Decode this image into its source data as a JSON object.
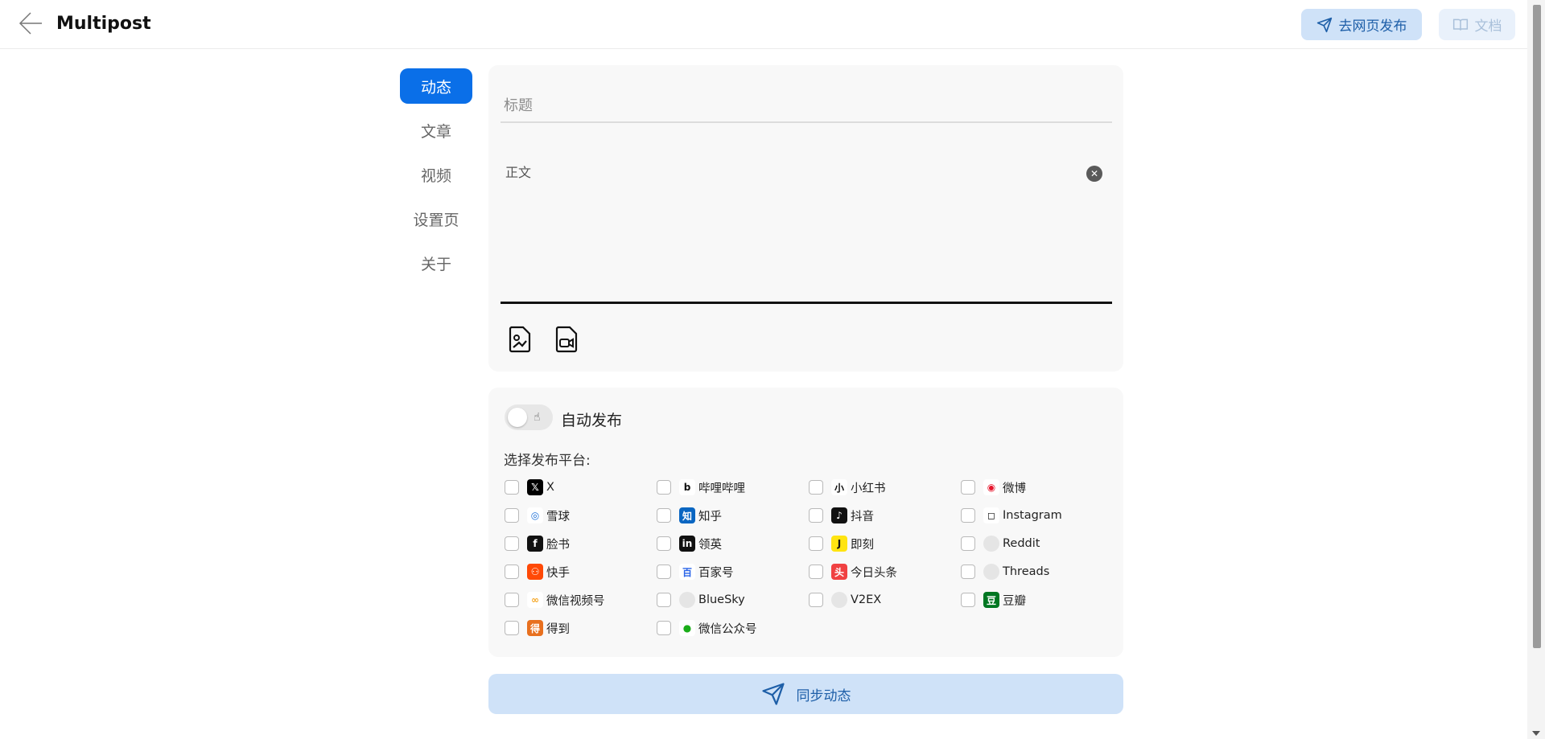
{
  "header": {
    "app_title": "Multipost",
    "web_publish_label": "去网页发布",
    "docs_label": "文档"
  },
  "nav": {
    "items": [
      {
        "label": "动态",
        "active": true
      },
      {
        "label": "文章",
        "active": false
      },
      {
        "label": "视频",
        "active": false
      },
      {
        "label": "设置页",
        "active": false
      },
      {
        "label": "关于",
        "active": false
      }
    ]
  },
  "editor": {
    "title_placeholder": "标题",
    "body_placeholder": "正文",
    "tools": [
      "image-upload-icon",
      "video-upload-icon"
    ]
  },
  "publish": {
    "auto_publish_label": "自动发布",
    "auto_publish_enabled": false,
    "choose_platform_label": "选择发布平台:",
    "platforms": [
      {
        "name": "X",
        "icon": "x-icon",
        "color": "#000000",
        "checked": false
      },
      {
        "name": "哔哩哔哩",
        "icon": "bilibili-icon",
        "color": "#ffffff",
        "checked": false
      },
      {
        "name": "小红书",
        "icon": "xiaohongshu-icon",
        "color": "#ffffff",
        "checked": false
      },
      {
        "name": "微博",
        "icon": "weibo-icon",
        "color": "#ffffff",
        "checked": false
      },
      {
        "name": "雪球",
        "icon": "xueqiu-icon",
        "color": "#ffffff",
        "checked": false
      },
      {
        "name": "知乎",
        "icon": "zhihu-icon",
        "color": "#0a66c2",
        "checked": false
      },
      {
        "name": "抖音",
        "icon": "douyin-icon",
        "color": "#111111",
        "checked": false
      },
      {
        "name": "Instagram",
        "icon": "instagram-icon",
        "color": "#ffffff",
        "checked": false
      },
      {
        "name": "脸书",
        "icon": "facebook-icon",
        "color": "#111111",
        "checked": false
      },
      {
        "name": "领英",
        "icon": "linkedin-icon",
        "color": "#111111",
        "checked": false
      },
      {
        "name": "即刻",
        "icon": "jike-icon",
        "color": "#ffe411",
        "checked": false
      },
      {
        "name": "Reddit",
        "icon": "reddit-icon",
        "color": "#e5e5e5",
        "checked": false
      },
      {
        "name": "快手",
        "icon": "kuaishou-icon",
        "color": "#ff4906",
        "checked": false
      },
      {
        "name": "百家号",
        "icon": "baijiahao-icon",
        "color": "#ffffff",
        "checked": false
      },
      {
        "name": "今日头条",
        "icon": "toutiao-icon",
        "color": "#f04142",
        "checked": false
      },
      {
        "name": "Threads",
        "icon": "threads-icon",
        "color": "#e5e5e5",
        "checked": false
      },
      {
        "name": "微信视频号",
        "icon": "wechat-channels-icon",
        "color": "#ffffff",
        "checked": false
      },
      {
        "name": "BlueSky",
        "icon": "bluesky-icon",
        "color": "#e5e5e5",
        "checked": false
      },
      {
        "name": "V2EX",
        "icon": "v2ex-icon",
        "color": "#e5e5e5",
        "checked": false
      },
      {
        "name": "豆瓣",
        "icon": "douban-icon",
        "color": "#007722",
        "checked": false
      },
      {
        "name": "得到",
        "icon": "dedao-icon",
        "color": "#e8701f",
        "checked": false
      },
      {
        "name": "微信公众号",
        "icon": "wechat-official-icon",
        "color": "#ffffff",
        "checked": false
      }
    ]
  },
  "sync_button_label": "同步动态"
}
